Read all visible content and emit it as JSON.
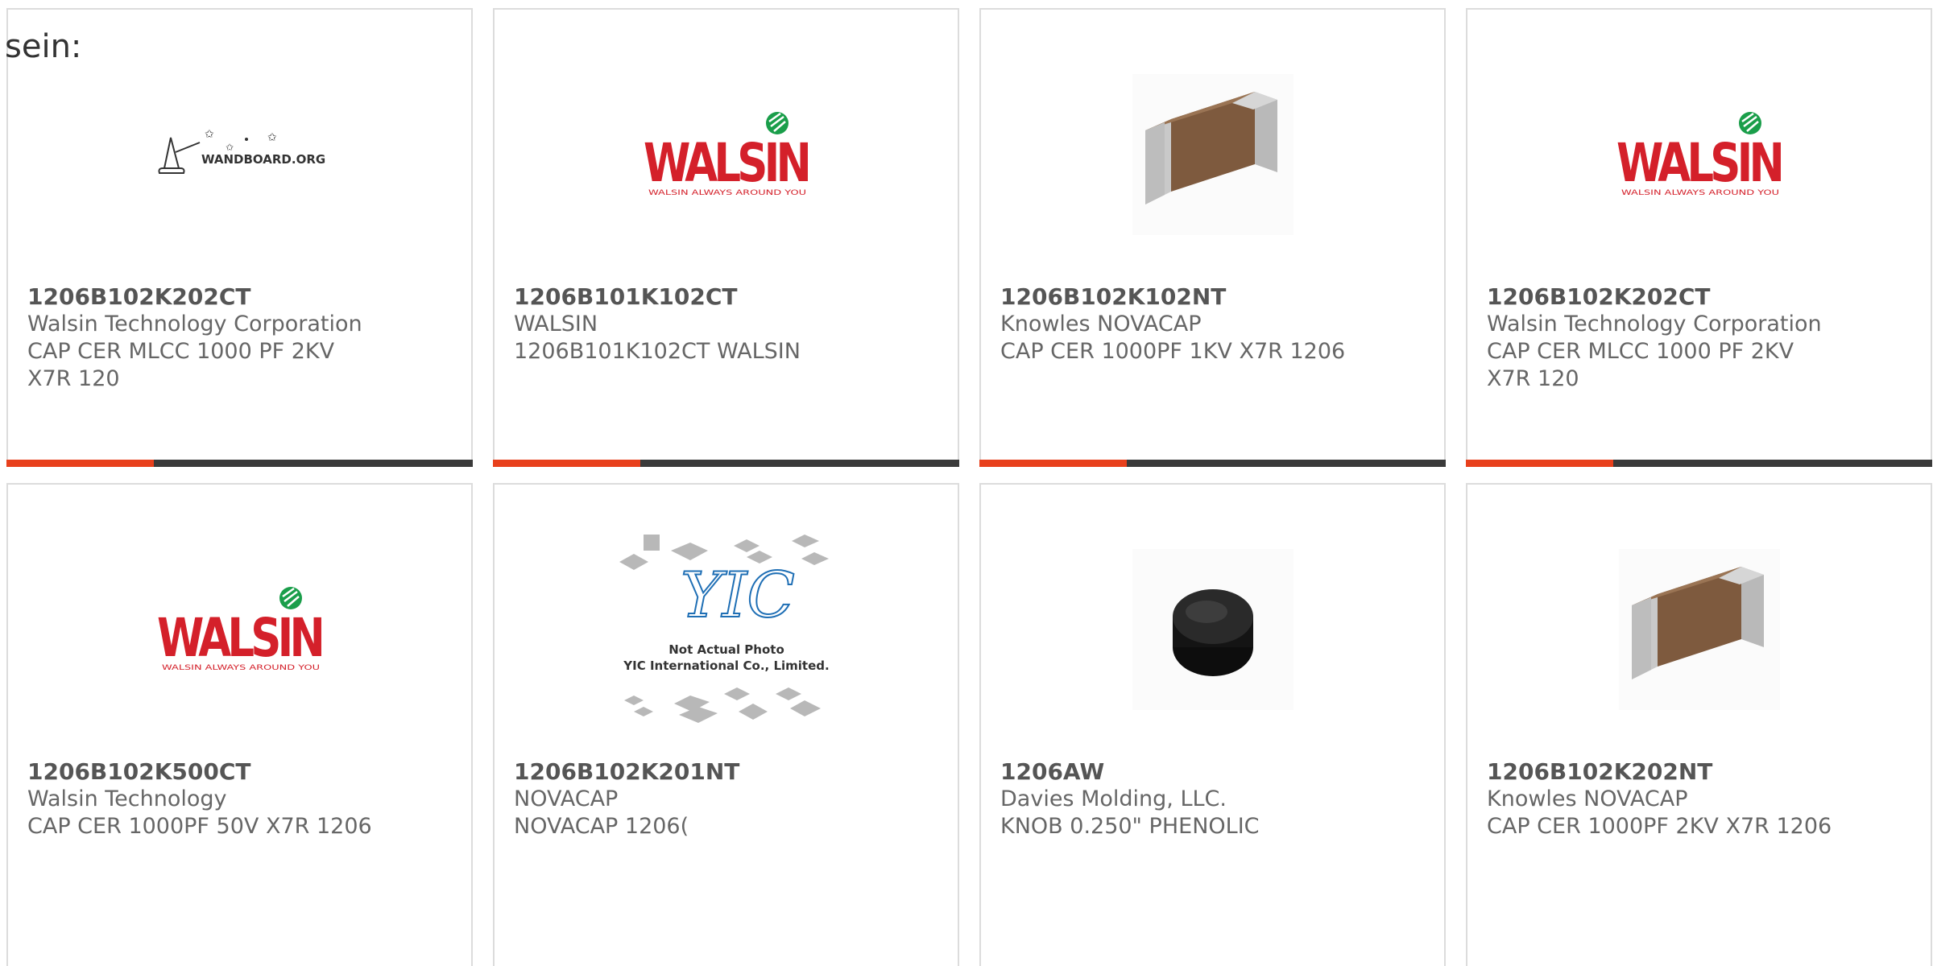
{
  "intro_text": "sein:",
  "colors": {
    "accent": "#e8401c",
    "bar": "#3a3a3a",
    "border": "#dcdcdc",
    "walsin_red": "#d4202a",
    "walsin_green": "#1a9e4a"
  },
  "cards": [
    {
      "image": "wandboard-logo",
      "logo_text": "WANDBOARD.ORG",
      "part_number": "1206B102K202CT",
      "manufacturer": "Walsin Technology Corporation",
      "description": "CAP CER MLCC 1000 PF 2KV X7R 120"
    },
    {
      "image": "walsin-logo",
      "logo_text": "WALSIN",
      "logo_tagline": "WALSIN ALWAYS AROUND YOU",
      "part_number": "1206B101K102CT",
      "manufacturer": "WALSIN",
      "description": "1206B101K102CT WALSIN"
    },
    {
      "image": "mlcc-chip-photo",
      "part_number": "1206B102K102NT",
      "manufacturer": "Knowles NOVACAP",
      "description": "CAP CER 1000PF 1KV X7R 1206"
    },
    {
      "image": "walsin-logo",
      "logo_text": "WALSIN",
      "logo_tagline": "WALSIN ALWAYS AROUND YOU",
      "part_number": "1206B102K202CT",
      "manufacturer": "Walsin Technology Corporation",
      "description": "CAP CER MLCC 1000 PF 2KV X7R 120"
    },
    {
      "image": "walsin-logo",
      "logo_text": "WALSIN",
      "logo_tagline": "WALSIN ALWAYS AROUND YOU",
      "part_number": "1206B102K500CT",
      "manufacturer": "Walsin Technology",
      "description": "CAP CER 1000PF 50V X7R 1206"
    },
    {
      "image": "yic-placeholder",
      "logo_text": "YIC",
      "placeholder_line1": "Not Actual Photo",
      "placeholder_line2": "YIC International Co., Limited.",
      "part_number": "1206B102K201NT",
      "manufacturer": "NOVACAP",
      "description": "NOVACAP 1206("
    },
    {
      "image": "knob-photo",
      "part_number": "1206AW",
      "manufacturer": "Davies Molding, LLC.",
      "description": "KNOB 0.250\" PHENOLIC"
    },
    {
      "image": "mlcc-chip-photo",
      "part_number": "1206B102K202NT",
      "manufacturer": "Knowles NOVACAP",
      "description": "CAP CER 1000PF 2KV X7R 1206"
    }
  ]
}
